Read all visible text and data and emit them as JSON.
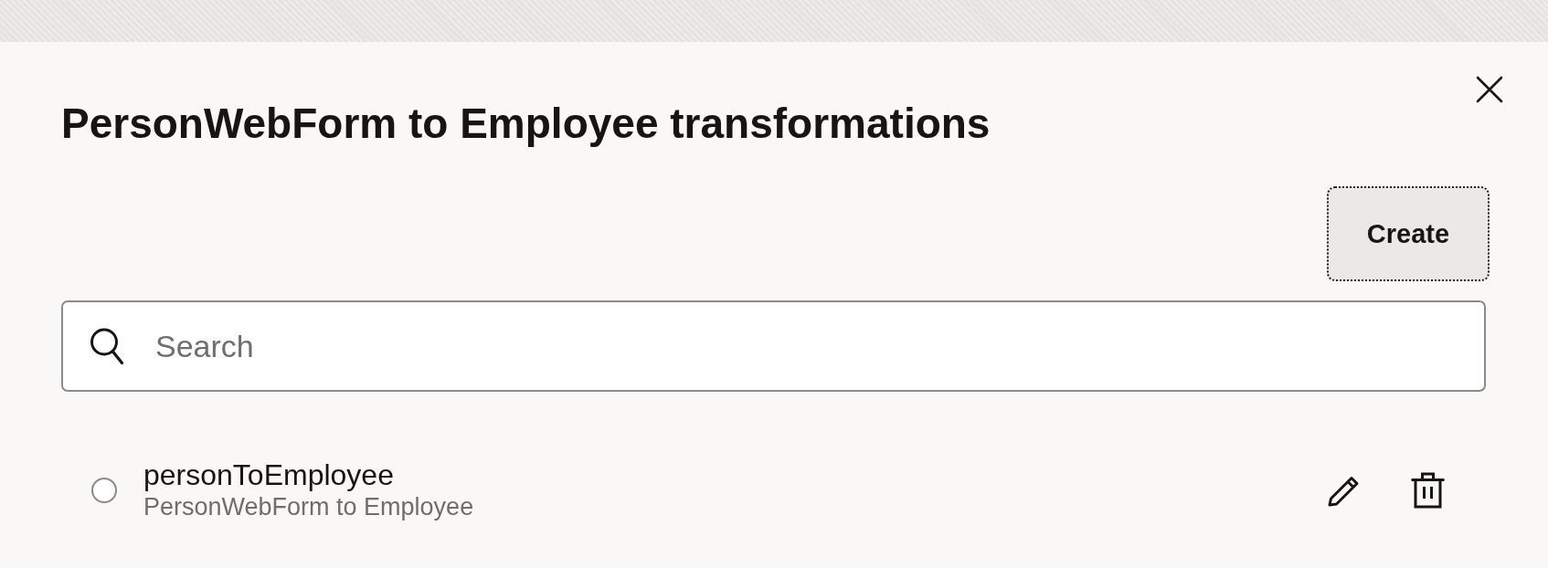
{
  "dialog": {
    "title": "PersonWebForm to Employee transformations"
  },
  "create_button": {
    "label": "Create",
    "focused": true
  },
  "search": {
    "placeholder": "Search"
  },
  "transformations": [
    {
      "name": "personToEmployee",
      "description": "PersonWebForm to Employee",
      "selected": false
    }
  ]
}
